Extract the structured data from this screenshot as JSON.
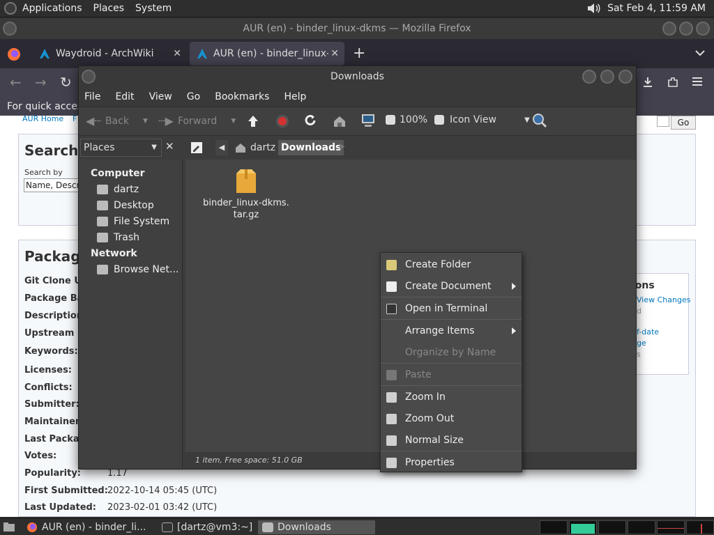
{
  "top_panel": {
    "menus": [
      "Applications",
      "Places",
      "System"
    ],
    "clock": "Sat Feb  4, 11:59 AM"
  },
  "firefox": {
    "title": "AUR (en) - binder_linux-dkms — Mozilla Firefox",
    "tabs": [
      {
        "label": "Waydroid - ArchWiki"
      },
      {
        "label": "AUR (en) - binder_linux-dkms"
      }
    ],
    "notice": "For quick access,",
    "page": {
      "aur_home": "AUR Home",
      "aur_nav_letter": "F",
      "search_heading": "Search C",
      "search_by": "Search by",
      "search_field": "Name, Descr",
      "go": "Go",
      "package_heading": "Package",
      "labels": [
        "Git Clone UF",
        "Package Bas",
        "Description:",
        "Upstream UI",
        "Keywords:",
        "Licenses:",
        "Conflicts:",
        "Submitter:",
        "Maintainer:",
        "Last Packag",
        "Votes:",
        "Popularity:",
        "First Submitted:",
        "Last Updated:"
      ],
      "popularity": "1.17",
      "first_submitted": "2022-10-14 05:45 (UTC)",
      "last_updated": "2023-02-01 03:42 (UTC)",
      "actions_heading": "ions",
      "action_links": [
        "View Changes",
        "d",
        "f-date",
        "ge",
        "s"
      ]
    }
  },
  "nautilus": {
    "title": "Downloads",
    "menubar": [
      "File",
      "Edit",
      "View",
      "Go",
      "Bookmarks",
      "Help"
    ],
    "toolbar": {
      "back": "Back",
      "forward": "Forward",
      "zoom": "100%",
      "view_mode": "Icon View"
    },
    "sidebar_selector": "Places",
    "path": [
      "dartz",
      "Downloads"
    ],
    "sidebar": {
      "computer_heading": "Computer",
      "computer_items": [
        "dartz",
        "Desktop",
        "File System",
        "Trash"
      ],
      "network_heading": "Network",
      "network_items": [
        "Browse Net..."
      ]
    },
    "file": {
      "name_line1": "binder_linux-dkms.",
      "name_line2": "tar.gz"
    },
    "status": "1 item, Free space: 51.0 GB"
  },
  "context_menu": {
    "items": [
      {
        "label": "Create Folder",
        "icon": "folder-new-icon"
      },
      {
        "label": "Create Document",
        "icon": "document-new-icon"
      },
      {
        "label": "Open in Terminal",
        "icon": "terminal-icon"
      },
      {
        "label": "Arrange Items"
      },
      {
        "label": "Organize by Name"
      },
      {
        "label": "Paste",
        "icon": "paste-icon"
      },
      {
        "label": "Zoom In",
        "icon": "zoom-in-icon"
      },
      {
        "label": "Zoom Out",
        "icon": "zoom-out-icon"
      },
      {
        "label": "Normal Size",
        "icon": "zoom-normal-icon"
      },
      {
        "label": "Properties",
        "icon": "properties-icon"
      }
    ]
  },
  "taskbar": {
    "tasks": [
      "AUR (en) - binder_li...",
      "[dartz@vm3:~]",
      "Downloads"
    ]
  },
  "colors": {
    "accent_blue": "#1a73e8",
    "folder_orange": "#e8a93a",
    "stop_red": "#d43030"
  }
}
